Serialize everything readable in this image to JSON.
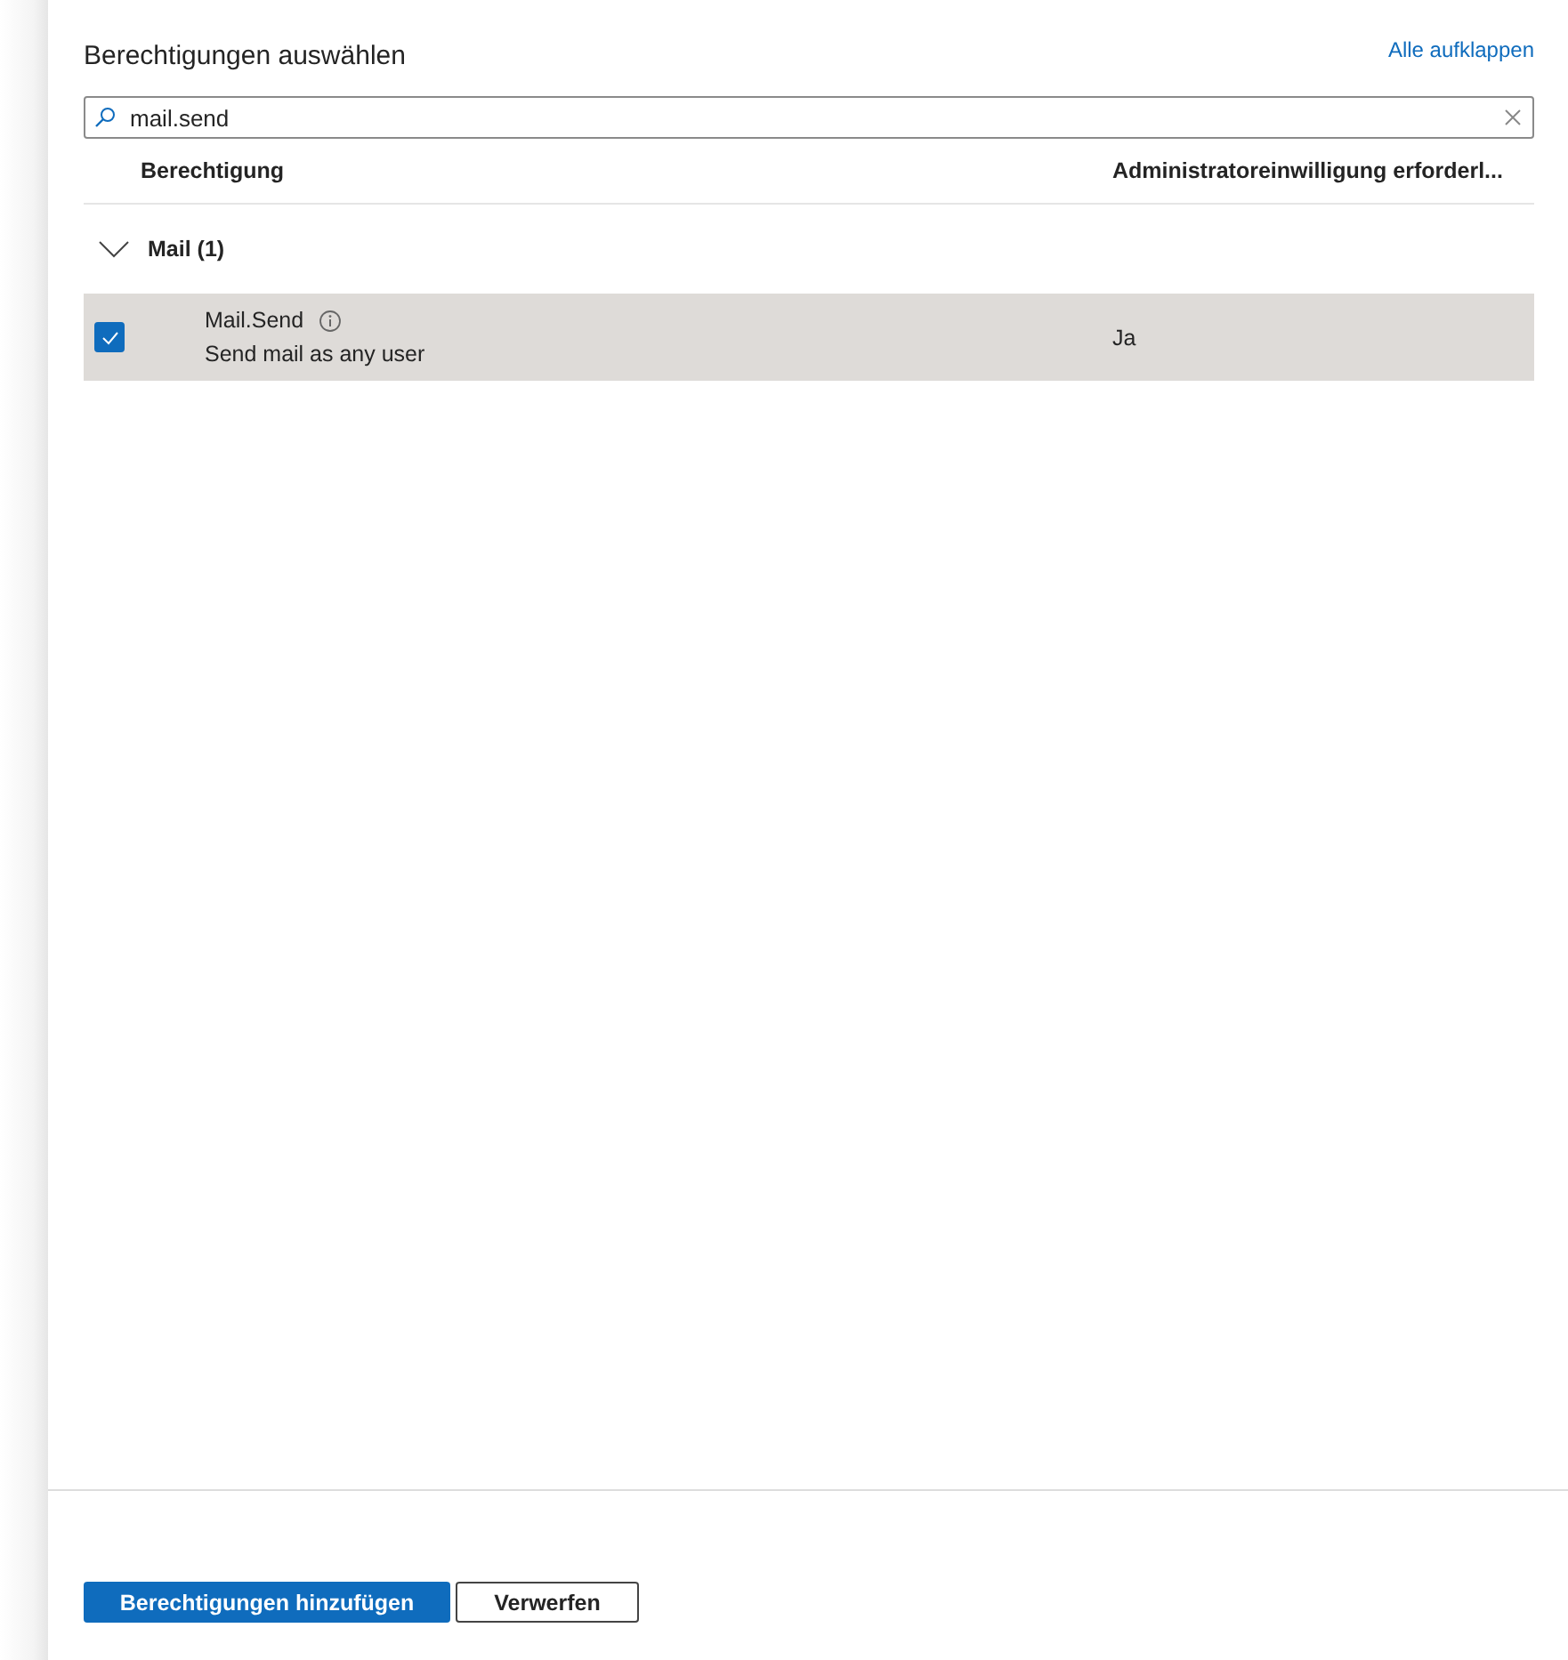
{
  "title": "Berechtigungen auswählen",
  "expand_all_link": "Alle aufklappen",
  "search": {
    "value": "mail.send"
  },
  "table": {
    "columns": [
      "Berechtigung",
      "Administratoreinwilligung erforderl..."
    ],
    "groups": [
      {
        "label": "Mail (1)",
        "expanded": true,
        "rows": [
          {
            "name": "Mail.Send",
            "description": "Send mail as any user",
            "admin_consent": "Ja",
            "checked": true,
            "selected": true
          }
        ]
      }
    ]
  },
  "buttons": [
    {
      "label": "Berechtigungen hinzufügen",
      "kind": "primary"
    },
    {
      "label": "Verwerfen",
      "kind": "secondary"
    }
  ]
}
